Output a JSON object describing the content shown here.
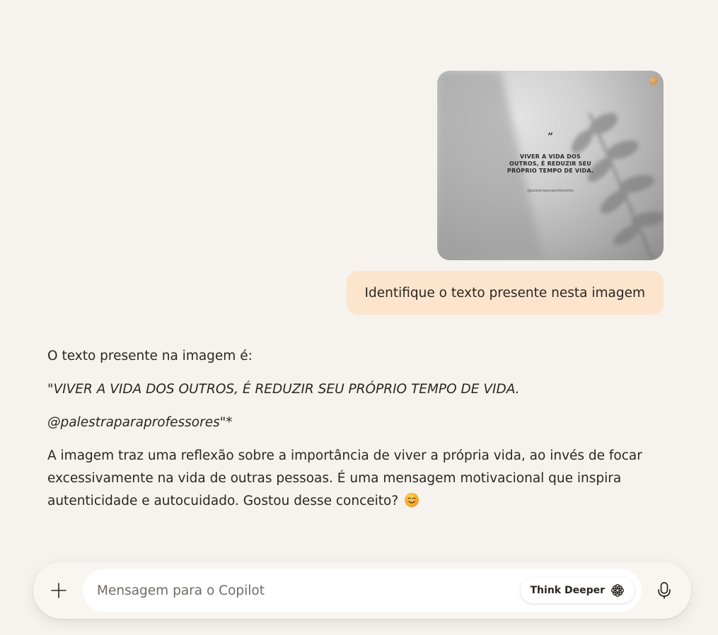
{
  "conversation": {
    "uploaded_image": {
      "quote_mark": "”",
      "quote_text": "VIVER A VIDA DOS\nOUTROS, É REDUZIR SEU\nPRÓPRIO TEMPO DE VIDA.",
      "handle": "@palestraparaprofessores"
    },
    "user_message": "Identifique o texto presente nesta imagem",
    "reply": {
      "intro": "O texto presente na imagem é:",
      "quote_line": "\"VIVER A VIDA DOS OUTROS, É REDUZIR SEU PRÓPRIO TEMPO DE VIDA.",
      "handle_italic": "@palestraparaprofessores",
      "handle_suffix": "\"*",
      "paragraph": "A imagem traz uma reflexão sobre a importância de viver a própria vida, ao invés de focar excessivamente na vida de outras pessoas. É uma mensagem motivacional que inspira autenticidade e autocuidado. Gostou desse conceito?",
      "emoji": "smiling-face-emoji"
    }
  },
  "composer": {
    "placeholder": "Mensagem para o Copilot",
    "value": "",
    "think_deeper_label": "Think Deeper",
    "icons": {
      "attach": "plus-icon",
      "think": "copilot-flower-icon",
      "voice": "microphone-icon"
    }
  },
  "colors": {
    "background": "#f6f3ef",
    "user_bubble": "#fde4cd",
    "composer": "#f9f6f2"
  }
}
